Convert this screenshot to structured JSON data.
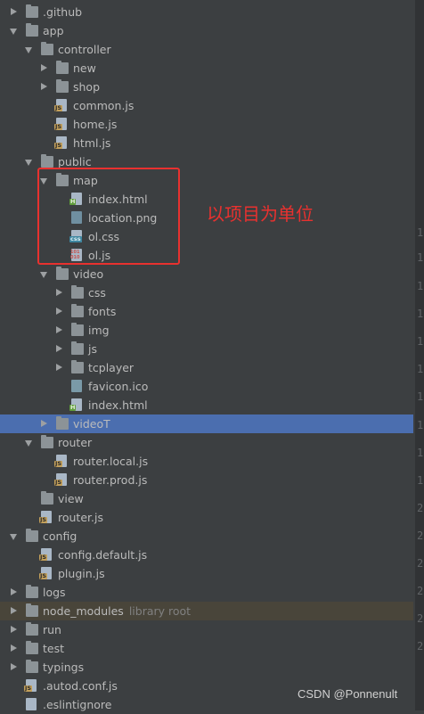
{
  "tree": [
    {
      "label": ".github",
      "type": "folder",
      "depth": 0,
      "expanded": false
    },
    {
      "label": "app",
      "type": "folder",
      "depth": 0,
      "expanded": true
    },
    {
      "label": "controller",
      "type": "folder",
      "depth": 1,
      "expanded": true
    },
    {
      "label": "new",
      "type": "folder",
      "depth": 2,
      "expanded": false
    },
    {
      "label": "shop",
      "type": "folder",
      "depth": 2,
      "expanded": false
    },
    {
      "label": "common.js",
      "type": "js",
      "depth": 2
    },
    {
      "label": "home.js",
      "type": "js",
      "depth": 2
    },
    {
      "label": "html.js",
      "type": "js",
      "depth": 2
    },
    {
      "label": "public",
      "type": "folder",
      "depth": 1,
      "expanded": true
    },
    {
      "label": "map",
      "type": "folder",
      "depth": 2,
      "expanded": true
    },
    {
      "label": "index.html",
      "type": "html",
      "depth": 3
    },
    {
      "label": "location.png",
      "type": "image",
      "depth": 3
    },
    {
      "label": "ol.css",
      "type": "css",
      "depth": 3
    },
    {
      "label": "ol.js",
      "type": "binary-js",
      "depth": 3
    },
    {
      "label": "video",
      "type": "folder",
      "depth": 2,
      "expanded": true
    },
    {
      "label": "css",
      "type": "folder",
      "depth": 3,
      "expanded": false
    },
    {
      "label": "fonts",
      "type": "folder",
      "depth": 3,
      "expanded": false
    },
    {
      "label": "img",
      "type": "folder",
      "depth": 3,
      "expanded": false
    },
    {
      "label": "js",
      "type": "folder",
      "depth": 3,
      "expanded": false
    },
    {
      "label": "tcplayer",
      "type": "folder",
      "depth": 3,
      "expanded": false
    },
    {
      "label": "favicon.ico",
      "type": "ico",
      "depth": 3
    },
    {
      "label": "index.html",
      "type": "html",
      "depth": 3
    },
    {
      "label": "videoT",
      "type": "folder",
      "depth": 2,
      "expanded": false,
      "selected": true
    },
    {
      "label": "router",
      "type": "folder",
      "depth": 1,
      "expanded": true
    },
    {
      "label": "router.local.js",
      "type": "js",
      "depth": 2
    },
    {
      "label": "router.prod.js",
      "type": "js",
      "depth": 2
    },
    {
      "label": "view",
      "type": "folder",
      "depth": 1,
      "leaf": true
    },
    {
      "label": "router.js",
      "type": "js",
      "depth": 1
    },
    {
      "label": "config",
      "type": "folder",
      "depth": 0,
      "expanded": true
    },
    {
      "label": "config.default.js",
      "type": "js",
      "depth": 1
    },
    {
      "label": "plugin.js",
      "type": "js",
      "depth": 1
    },
    {
      "label": "logs",
      "type": "folder",
      "depth": 0,
      "expanded": false
    },
    {
      "label": "node_modules",
      "type": "folder",
      "depth": 0,
      "expanded": false,
      "hint": "library root",
      "highlight": true
    },
    {
      "label": "run",
      "type": "folder",
      "depth": 0,
      "expanded": false
    },
    {
      "label": "test",
      "type": "folder",
      "depth": 0,
      "expanded": false
    },
    {
      "label": "typings",
      "type": "folder",
      "depth": 0,
      "expanded": false
    },
    {
      "label": ".autod.conf.js",
      "type": "js",
      "depth": 0
    },
    {
      "label": ".eslintignore",
      "type": "text",
      "depth": 0
    }
  ],
  "gutter_numbers": [
    "1",
    "1",
    "1",
    "1",
    "1",
    "1",
    "1",
    "1",
    "1",
    "1",
    "2",
    "2",
    "2",
    "2",
    "2",
    "2"
  ],
  "annotation": {
    "text": "以项目为单位",
    "color": "#e8312f"
  },
  "watermark": "CSDN @Ponnenult",
  "colors": {
    "background": "#3c3f41",
    "selection": "#4b6eaf",
    "annotation": "#e8312f"
  }
}
